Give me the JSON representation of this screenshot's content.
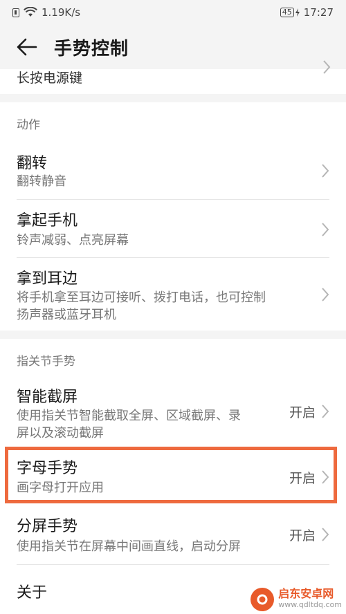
{
  "status_bar": {
    "network_speed": "1.19K/s",
    "battery_level": "45",
    "time": "17:27"
  },
  "header": {
    "title": "手势控制"
  },
  "top_card": {
    "partial_item_label": "长按电源键"
  },
  "sections": {
    "action": {
      "header": "动作",
      "items": [
        {
          "title": "翻转",
          "subtitle": "翻转静音"
        },
        {
          "title": "拿起手机",
          "subtitle": "铃声减弱、点亮屏幕"
        },
        {
          "title": "拿到耳边",
          "subtitle_line1": "将手机拿至耳边可接听、拨打电话，也可控制",
          "subtitle_line2": "扬声器或蓝牙耳机"
        }
      ]
    },
    "knuckle": {
      "header": "指关节手势",
      "items": [
        {
          "title": "智能截屏",
          "subtitle_line1": "使用指关节智能截取全屏、区域截屏、录",
          "subtitle_line2": "屏以及滚动截屏",
          "status": "开启"
        },
        {
          "title": "字母手势",
          "subtitle": "画字母打开应用",
          "status": "开启"
        },
        {
          "title": "分屏手势",
          "subtitle": "使用指关节在屏幕中间画直线，启动分屏",
          "status": "开启"
        },
        {
          "title": "关于"
        }
      ]
    }
  },
  "watermark": {
    "name": "启东安卓网",
    "url": "www.qdltdq.com"
  },
  "colors": {
    "highlight": "#ee6a3e",
    "watermark": "#e85a2a"
  }
}
